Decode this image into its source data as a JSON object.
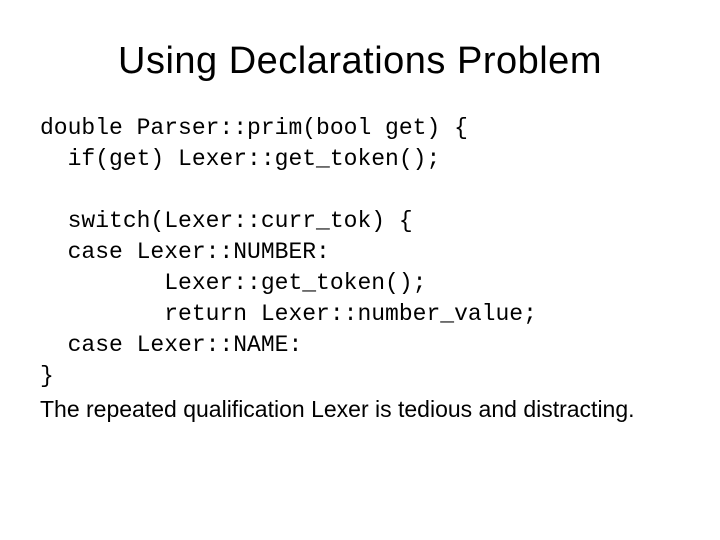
{
  "title": "Using Declarations Problem",
  "code": "double Parser::prim(bool get) {\n  if(get) Lexer::get_token();\n\n  switch(Lexer::curr_tok) {\n  case Lexer::NUMBER:\n         Lexer::get_token();\n         return Lexer::number_value;\n  case Lexer::NAME:\n}",
  "note": "The repeated qualification Lexer is  tedious and distracting."
}
